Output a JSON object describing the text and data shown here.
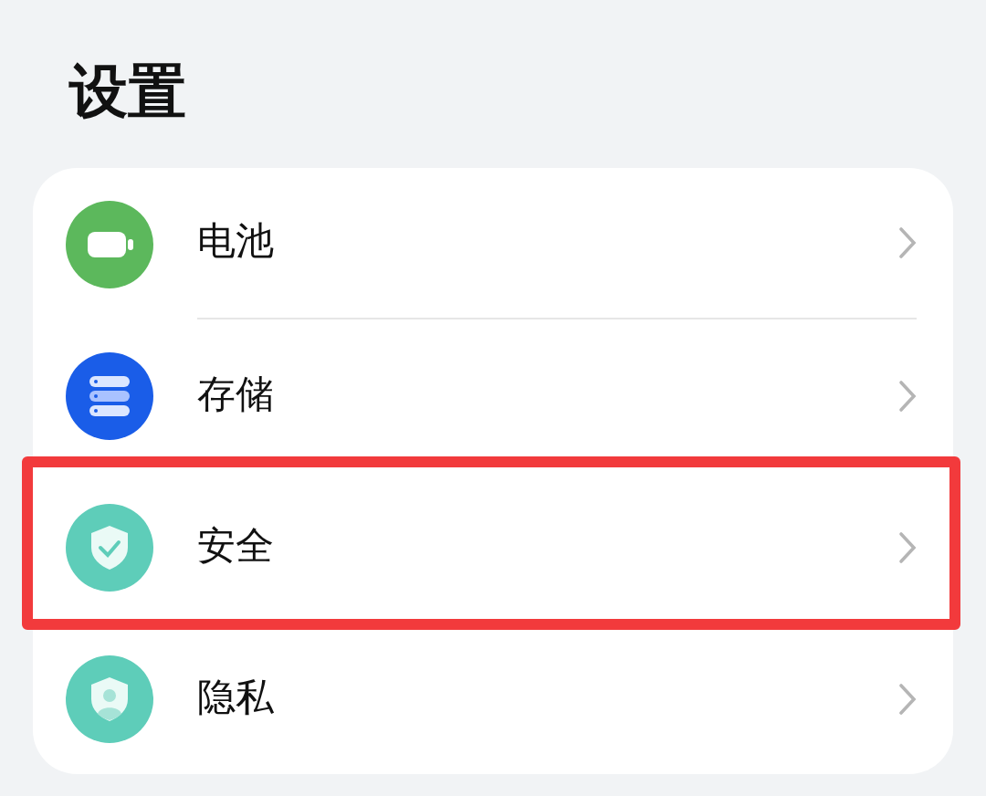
{
  "title": "设置",
  "items": [
    {
      "kind": "battery",
      "label": "电池",
      "color": "#5cb85c",
      "highlighted": false
    },
    {
      "kind": "storage",
      "label": "存储",
      "color": "#1a5de8",
      "highlighted": false
    },
    {
      "kind": "security",
      "label": "安全",
      "color": "#5ecdb9",
      "highlighted": true
    },
    {
      "kind": "privacy",
      "label": "隐私",
      "color": "#5ecdb9",
      "highlighted": false
    }
  ]
}
